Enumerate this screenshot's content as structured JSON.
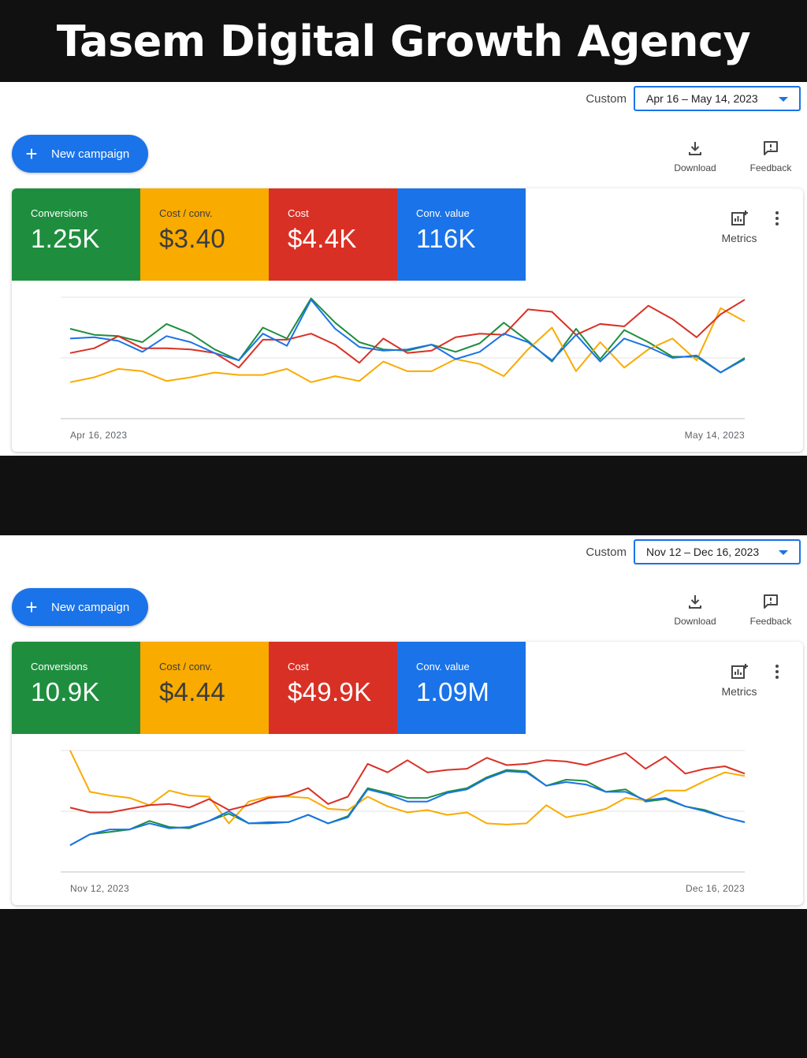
{
  "header": {
    "title": "Tasem Digital Growth Agency"
  },
  "panels": [
    {
      "date": {
        "label": "Custom",
        "range": "Apr 16 – May 14, 2023"
      },
      "new_campaign_label": "New campaign",
      "download_label": "Download",
      "feedback_label": "Feedback",
      "metrics_label": "Metrics",
      "tiles": [
        {
          "label": "Conversions",
          "value": "1.25K",
          "color": "#1e8e3e"
        },
        {
          "label": "Cost / conv.",
          "value": "$3.40",
          "color": "#f9ab00"
        },
        {
          "label": "Cost",
          "value": "$4.4K",
          "color": "#d93025"
        },
        {
          "label": "Conv. value",
          "value": "116K",
          "color": "#1a73e8"
        }
      ],
      "x_start": "Apr 16, 2023",
      "x_end": "May 14, 2023"
    },
    {
      "date": {
        "label": "Custom",
        "range": "Nov 12 – Dec 16, 2023"
      },
      "new_campaign_label": "New campaign",
      "download_label": "Download",
      "feedback_label": "Feedback",
      "metrics_label": "Metrics",
      "tiles": [
        {
          "label": "Conversions",
          "value": "10.9K",
          "color": "#1e8e3e"
        },
        {
          "label": "Cost / conv.",
          "value": "$4.44",
          "color": "#f9ab00"
        },
        {
          "label": "Cost",
          "value": "$49.9K",
          "color": "#d93025"
        },
        {
          "label": "Conv. value",
          "value": "1.09M",
          "color": "#1a73e8"
        }
      ],
      "x_start": "Nov 12, 2023",
      "x_end": "Dec 16, 2023"
    }
  ],
  "chart_data": [
    {
      "type": "line",
      "x_range": [
        "Apr 16, 2023",
        "May 14, 2023"
      ],
      "ylim": [
        0,
        100
      ],
      "grid": true,
      "series": [
        {
          "name": "Conversions",
          "color": "#1e8e3e",
          "values": [
            74,
            69,
            68,
            63,
            78,
            70,
            57,
            48,
            75,
            66,
            99,
            79,
            63,
            57,
            56,
            61,
            55,
            62,
            79,
            64,
            47,
            74,
            49,
            73,
            63,
            51,
            51,
            38,
            50
          ]
        },
        {
          "name": "Cost / conv.",
          "color": "#f9ab00",
          "values": [
            30,
            34,
            41,
            39,
            31,
            34,
            38,
            36,
            36,
            41,
            30,
            35,
            31,
            47,
            39,
            39,
            49,
            45,
            35,
            57,
            75,
            39,
            63,
            42,
            57,
            66,
            48,
            91,
            80
          ]
        },
        {
          "name": "Cost",
          "color": "#d93025",
          "values": [
            54,
            58,
            68,
            58,
            58,
            57,
            54,
            42,
            65,
            65,
            70,
            61,
            46,
            66,
            54,
            56,
            67,
            70,
            69,
            90,
            88,
            69,
            78,
            76,
            93,
            82,
            67,
            86,
            98
          ]
        },
        {
          "name": "Conv. value",
          "color": "#1a73e8",
          "values": [
            66,
            67,
            64,
            55,
            68,
            63,
            54,
            48,
            70,
            60,
            98,
            74,
            59,
            56,
            57,
            61,
            49,
            55,
            70,
            63,
            48,
            69,
            47,
            66,
            59,
            50,
            52,
            38,
            49
          ]
        }
      ]
    },
    {
      "type": "line",
      "x_range": [
        "Nov 12, 2023",
        "Dec 16, 2023"
      ],
      "ylim": [
        0,
        100
      ],
      "grid": true,
      "series": [
        {
          "name": "Conversions",
          "color": "#1e8e3e",
          "values": [
            22,
            31,
            33,
            35,
            42,
            37,
            36,
            42,
            48,
            40,
            40,
            41,
            47,
            40,
            46,
            69,
            65,
            61,
            61,
            66,
            69,
            78,
            84,
            83,
            71,
            76,
            75,
            66,
            68,
            58,
            60,
            54,
            51,
            45,
            41
          ]
        },
        {
          "name": "Cost / conv.",
          "color": "#f9ab00",
          "values": [
            100,
            66,
            63,
            61,
            55,
            67,
            63,
            62,
            40,
            58,
            62,
            62,
            61,
            52,
            51,
            62,
            54,
            49,
            51,
            47,
            49,
            40,
            39,
            40,
            55,
            45,
            48,
            52,
            61,
            59,
            67,
            67,
            75,
            82,
            79
          ]
        },
        {
          "name": "Cost",
          "color": "#d93025",
          "values": [
            53,
            49,
            49,
            52,
            55,
            56,
            53,
            60,
            51,
            55,
            61,
            63,
            69,
            56,
            62,
            89,
            82,
            92,
            82,
            84,
            85,
            94,
            88,
            89,
            92,
            91,
            88,
            93,
            98,
            85,
            95,
            81,
            85,
            87,
            81
          ]
        },
        {
          "name": "Conv. value",
          "color": "#1a73e8",
          "values": [
            22,
            31,
            35,
            35,
            40,
            36,
            37,
            42,
            50,
            40,
            41,
            41,
            47,
            40,
            45,
            68,
            64,
            58,
            58,
            65,
            68,
            77,
            83,
            82,
            71,
            74,
            72,
            66,
            66,
            59,
            61,
            54,
            50,
            45,
            41
          ]
        }
      ]
    }
  ]
}
